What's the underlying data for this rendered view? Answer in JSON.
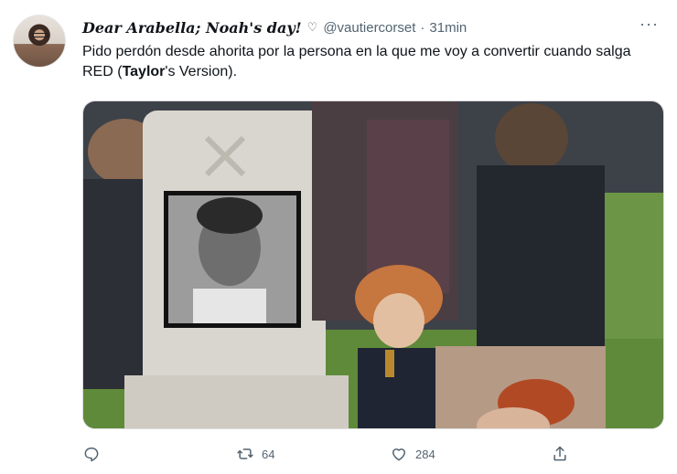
{
  "tweet": {
    "display_name": "Dear Arabella; Noah's day!",
    "name_icon": "heart-outline-icon",
    "handle": "@vautiercorset",
    "separator": "·",
    "time": "31min",
    "more_label": "···",
    "text_before": "Pido perdón desde ahorita por la persona en la que me voy a convertir cuando salga RED (",
    "text_bold": "Taylor",
    "text_after": "'s Version).",
    "media_alt": "meme image"
  },
  "actions": {
    "reply": {
      "icon": "reply-icon",
      "count": ""
    },
    "retweet": {
      "icon": "retweet-icon",
      "count": "64"
    },
    "like": {
      "icon": "heart-icon",
      "count": "284"
    },
    "share": {
      "icon": "share-icon",
      "count": ""
    }
  },
  "colors": {
    "text_primary": "#0f1419",
    "text_secondary": "#536471",
    "background": "#ffffff"
  }
}
